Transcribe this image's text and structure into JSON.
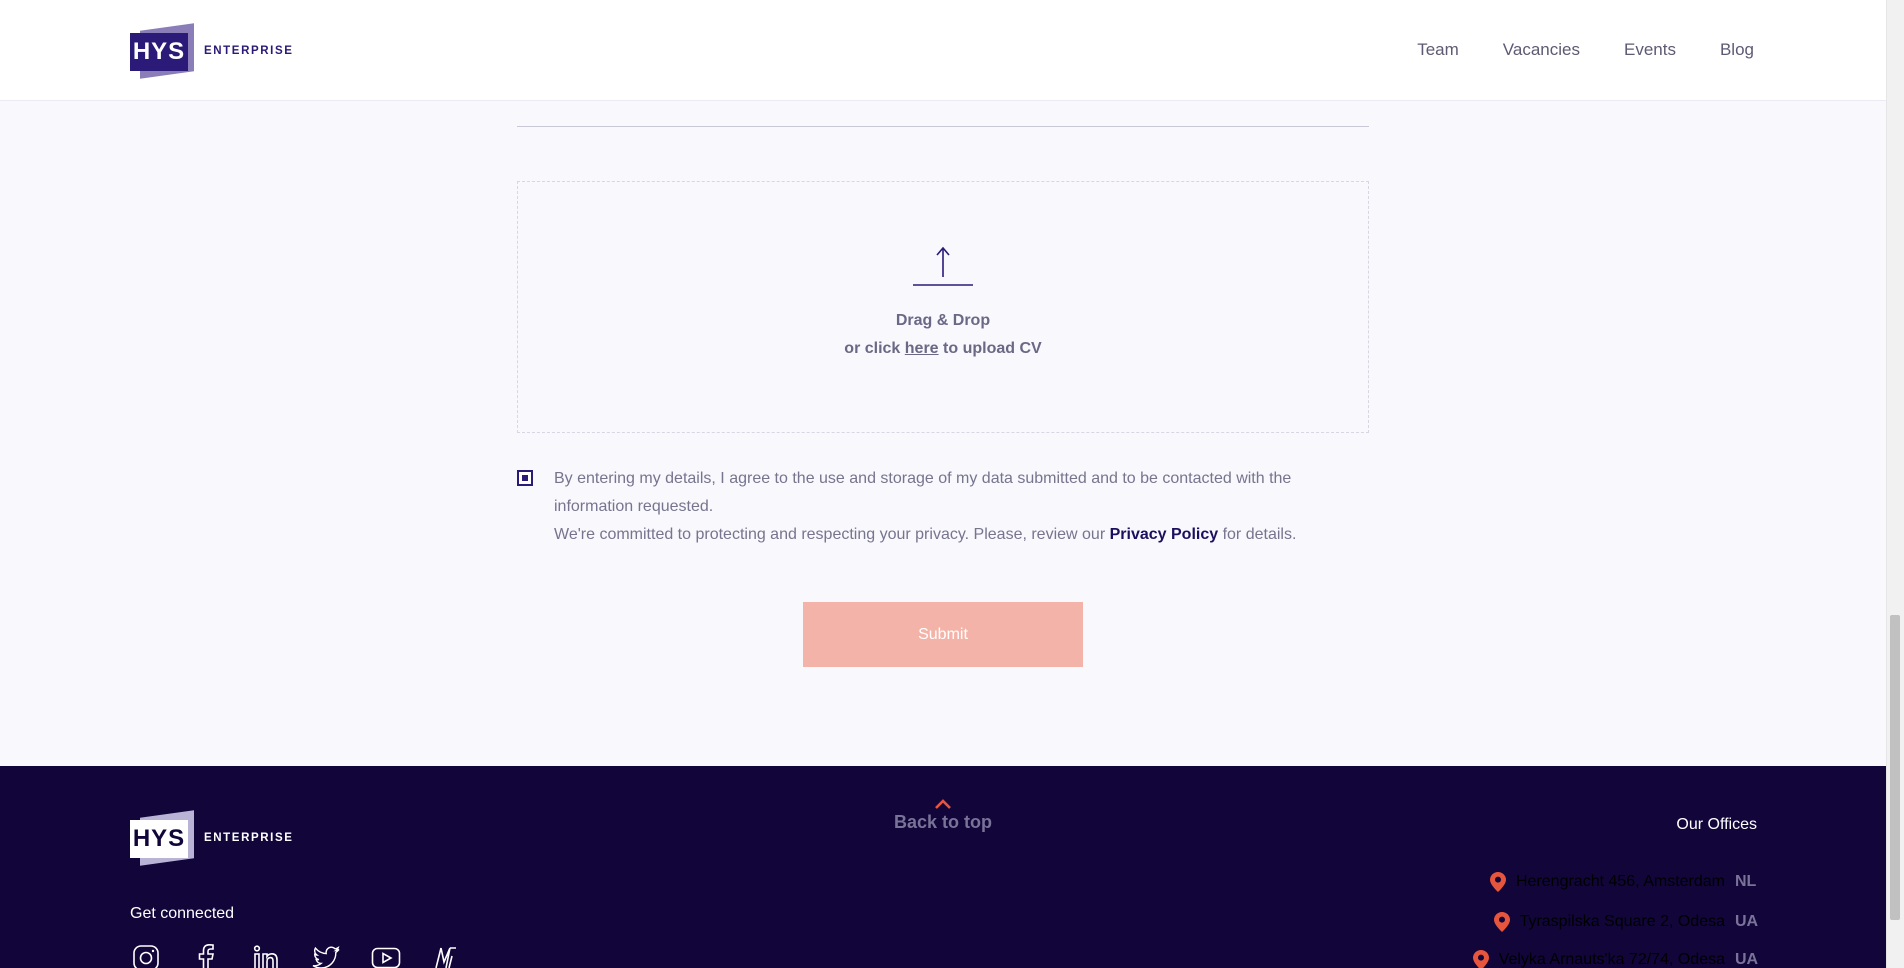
{
  "header": {
    "logo_main": "HYS",
    "logo_sub": "ENTERPRISE",
    "nav": [
      {
        "label": "Team"
      },
      {
        "label": "Vacancies"
      },
      {
        "label": "Events"
      },
      {
        "label": "Blog"
      }
    ]
  },
  "upload": {
    "icon": "upload-arrow-icon",
    "title": "Drag & Drop",
    "sub_prefix": "or click",
    "sub_link": "here",
    "sub_suffix": "to upload CV"
  },
  "consent": {
    "checked": true,
    "text1": "By entering my details, I agree to the use and storage of my data submitted and to be contacted with the information requested.",
    "text2_prefix": "We're committed to protecting and respecting your privacy. Please, review our",
    "privacy_link": "Privacy Policy",
    "text2_suffix": "for details."
  },
  "form": {
    "submit_label": "Submit"
  },
  "footer": {
    "logo_main": "HYS",
    "logo_sub": "ENTERPRISE",
    "get_connected": "Get connected",
    "socials": [
      "instagram-icon",
      "facebook-icon",
      "linkedin-icon",
      "twitter-icon",
      "youtube-icon",
      "medium-icon"
    ],
    "back_to_top": "Back to top",
    "offices_title": "Our Offices",
    "offices": [
      {
        "address": "Herengracht 456, Amsterdam",
        "country": "NL"
      },
      {
        "address": "Tyraspilska Square 2, Odesa",
        "country": "UA"
      },
      {
        "address": "Velyka Arnauts'ka 72/74, Odesa",
        "country": "UA"
      }
    ]
  },
  "colors": {
    "brand": "#2b1a77",
    "footer_bg": "#12053a",
    "accent": "#e8553d",
    "submit_bg": "#f4b3a8"
  }
}
